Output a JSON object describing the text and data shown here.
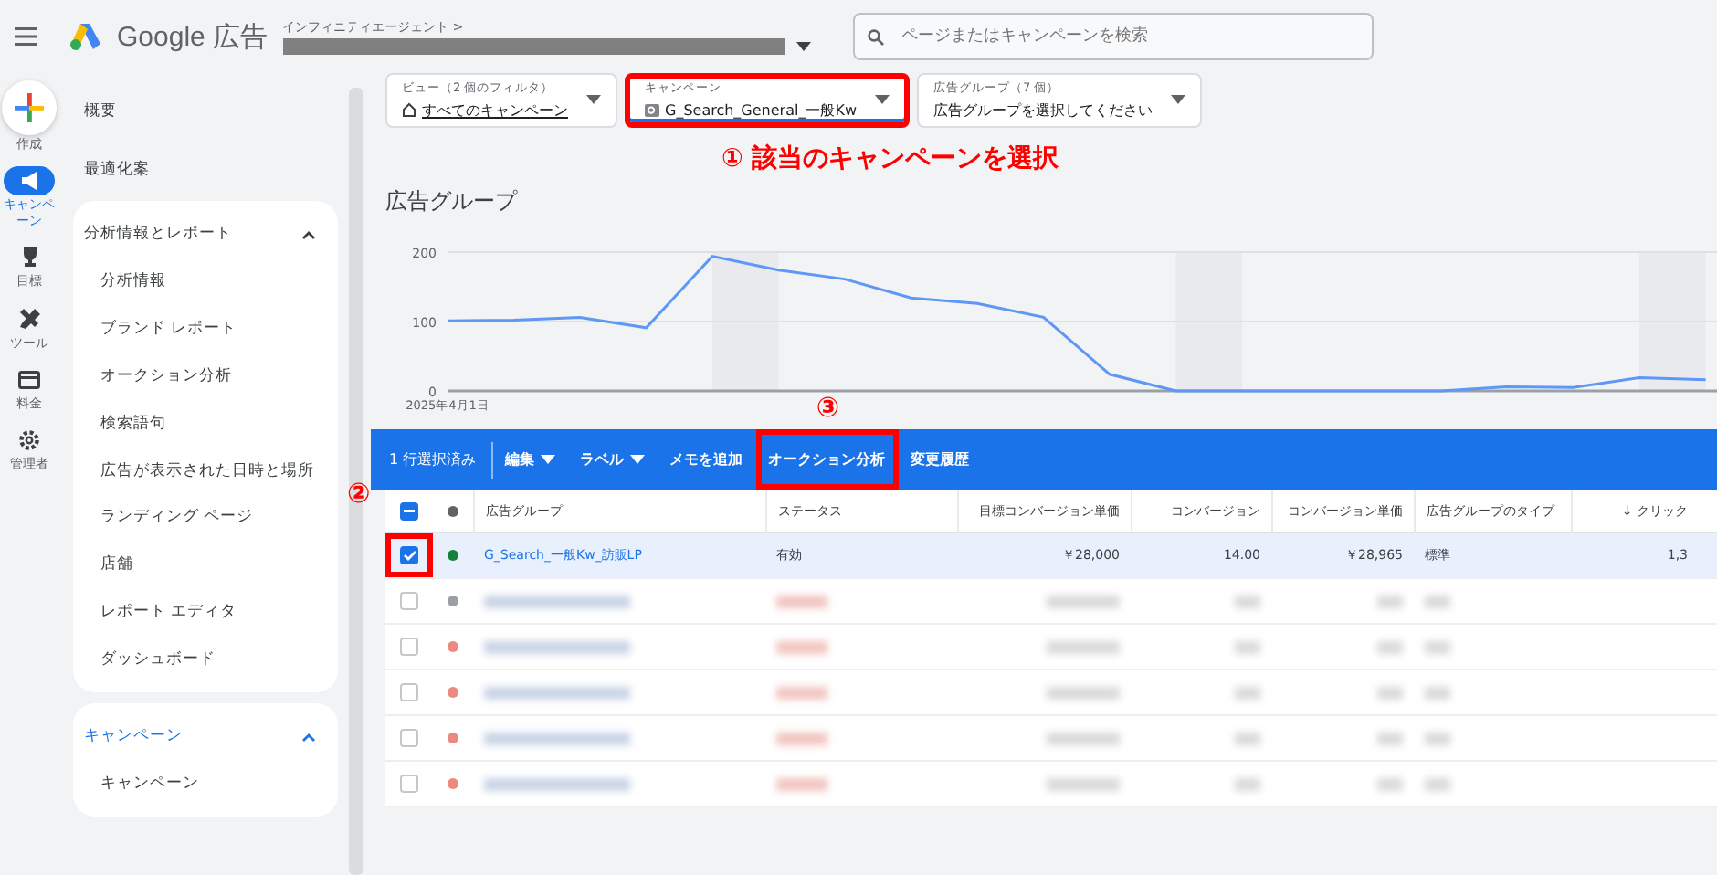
{
  "topbar": {
    "product": "Google 広告",
    "account_path": "インフィニティエージェント >",
    "search": {
      "placeholder": "ページまたはキャンペーンを検索"
    }
  },
  "rail": [
    {
      "label": "作成",
      "kind": "create",
      "selected": false
    },
    {
      "label": "キャンペーン",
      "kind": "campaign",
      "selected": true
    },
    {
      "label": "目標",
      "kind": "goal",
      "selected": false
    },
    {
      "label": "ツール",
      "kind": "tools",
      "selected": false
    },
    {
      "label": "料金",
      "kind": "billing",
      "selected": false
    },
    {
      "label": "管理者",
      "kind": "admin",
      "selected": false
    }
  ],
  "sidebar": {
    "top_items": [
      "概要",
      "最適化案"
    ],
    "sections": [
      {
        "title": "分析情報とレポート",
        "expanded": true,
        "active": false,
        "items": [
          "分析情報",
          "ブランド レポート",
          "オークション分析",
          "検索語句",
          "広告が表示された日時と場所",
          "ランディング ページ",
          "店舗",
          "レポート エディタ",
          "ダッシュボード"
        ]
      },
      {
        "title": "キャンペーン",
        "expanded": true,
        "active": true,
        "items": [
          "キャンペーン"
        ]
      }
    ]
  },
  "filters": [
    {
      "label": "ビュー（2 個のフィルタ）",
      "value": "すべてのキャンペーン",
      "kind": "view",
      "highlighted": false
    },
    {
      "label": "キャンペーン",
      "value": "G_Search_General_一般Kw",
      "kind": "campaign",
      "highlighted": true
    },
    {
      "label": "広告グループ（7 個）",
      "value": "広告グループを選択してください",
      "kind": "plain",
      "highlighted": false
    }
  ],
  "annotations": {
    "step1": "① 該当のキャンペーンを選択",
    "step2": "②",
    "step3": "③"
  },
  "page_title": "広告グループ",
  "chart_data": {
    "type": "line",
    "categories": [
      "2025年4月1日",
      null,
      null,
      null,
      null,
      null,
      null,
      null,
      null,
      null,
      null,
      null,
      null,
      null,
      null,
      null,
      null,
      null,
      null,
      null
    ],
    "yticks": [
      0,
      100,
      200
    ],
    "ylim": [
      0,
      200
    ],
    "series": [
      {
        "color": "#5e97f6",
        "values": [
          101,
          102,
          106,
          91,
          194,
          174,
          161,
          134,
          126,
          106,
          24,
          0,
          0,
          0,
          0,
          0,
          6,
          5,
          19,
          16
        ]
      }
    ]
  },
  "toolbar": {
    "selection": "1 行選択済み",
    "actions": [
      {
        "label": "編集",
        "menu": true,
        "highlighted": false
      },
      {
        "label": "ラベル",
        "menu": true,
        "highlighted": false
      },
      {
        "label": "メモを追加",
        "menu": false,
        "highlighted": false
      },
      {
        "label": "オークション分析",
        "menu": false,
        "highlighted": true
      },
      {
        "label": "変更履歴",
        "menu": false,
        "highlighted": false
      }
    ]
  },
  "table": {
    "header_checkbox": {
      "indeterminate": true
    },
    "columns": [
      "広告グループ",
      "ステータス",
      "目標コンバージョン単価",
      "コンバージョン",
      "コンバージョン単価",
      "広告グループのタイプ",
      "↓ クリック"
    ],
    "rows": [
      {
        "checked": true,
        "highlighted": true,
        "color": "#188038",
        "cells": [
          "G_Search_一般Kw_訪販LP",
          "有効",
          "￥28,000",
          "14.00",
          "￥28,965",
          "標準",
          "1,3"
        ]
      }
    ],
    "blurred_rows": [
      {
        "checked": false,
        "color": "#9aa0a6"
      },
      {
        "checked": false,
        "color": "#ea8a80"
      },
      {
        "checked": false,
        "color": "#ea8a80"
      },
      {
        "checked": false,
        "color": "#ea8a80"
      },
      {
        "checked": false,
        "color": "#ea8a80"
      }
    ]
  }
}
